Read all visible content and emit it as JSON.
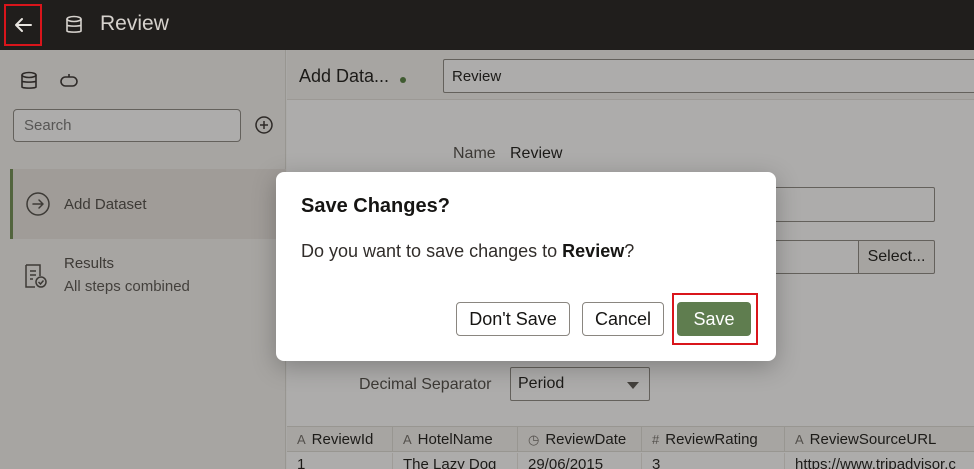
{
  "header": {
    "title": "Review"
  },
  "left_panel": {
    "search_placeholder": "Search",
    "steps": [
      {
        "label": "Add Dataset"
      },
      {
        "label": "Results",
        "sublabel": "All steps combined"
      }
    ]
  },
  "main": {
    "breadcrumb": "Add Data...",
    "name_box_value": "Review",
    "name_label": "Name",
    "name_value": "Review",
    "select_button_label": "Select...",
    "decimal_label": "Decimal Separator",
    "decimal_value": "Period",
    "table": {
      "columns": [
        {
          "label": "ReviewId",
          "type_icon": "A"
        },
        {
          "label": "HotelName",
          "type_icon": "A"
        },
        {
          "label": "ReviewDate",
          "type_icon": "◷"
        },
        {
          "label": "ReviewRating",
          "type_icon": "#"
        },
        {
          "label": "ReviewSourceURL",
          "type_icon": "A"
        }
      ],
      "first_row": [
        "1",
        "The Lazy Dog",
        "29/06/2015",
        "3",
        "https://www.tripadvisor.c"
      ]
    }
  },
  "dialog": {
    "title": "Save Changes?",
    "message_prefix": "Do you want to save changes to ",
    "message_name": "Review",
    "message_suffix": "?",
    "buttons": {
      "dont_save": "Don't Save",
      "cancel": "Cancel",
      "save": "Save"
    }
  },
  "colors": {
    "accent": "#5f7d4f",
    "highlight": "#d9151b",
    "header_bg": "#201e1c"
  }
}
